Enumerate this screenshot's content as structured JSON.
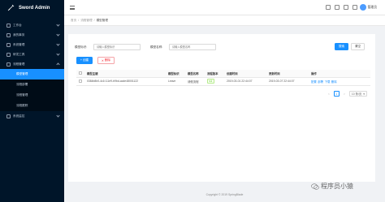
{
  "brand": {
    "title": "Sword Admin",
    "logo_icon": "sword-icon"
  },
  "sidebar": {
    "items": [
      {
        "label": "工作台",
        "icon": "desktop-icon",
        "open": false
      },
      {
        "label": "我的事务",
        "icon": "inbox-icon",
        "open": false
      },
      {
        "label": "系统管理",
        "icon": "setting-icon",
        "open": false
      },
      {
        "label": "研发工具",
        "icon": "tool-icon",
        "open": false
      },
      {
        "label": "流程管理",
        "icon": "flow-icon",
        "open": true
      }
    ],
    "subitems": [
      {
        "label": "模型管理",
        "active": true
      },
      {
        "label": "流程部署",
        "active": false
      },
      {
        "label": "流程管理",
        "active": false
      },
      {
        "label": "流程跟踪",
        "active": false
      }
    ],
    "tail": {
      "label": "系统监控",
      "icon": "monitor-icon"
    }
  },
  "header": {
    "user_name": "管理员"
  },
  "breadcrumb": {
    "home": "首页",
    "parent": "流程管理",
    "current": "模型管理"
  },
  "search": {
    "key_label": "模型标识:",
    "key_placeholder": "请输入模型标识",
    "name_label": "模型名称:",
    "name_placeholder": "请输入模型名称",
    "search_button": "搜索",
    "reset_button": "清空"
  },
  "toolbar": {
    "create_button": "+ 创建",
    "delete_button": "删除"
  },
  "table": {
    "headers": [
      "模型主键",
      "模型标识",
      "模型名称",
      "流程版本",
      "创建时间",
      "更新时间",
      "操作"
    ],
    "rows": [
      {
        "id": "0384b8b0-4c1f-11e9-b9bd-acde48001122",
        "key": "Leave",
        "name": "请假流程",
        "version": "v1",
        "created": "2019-03-01 22:44:07",
        "updated": "2019-03-07 22:44:07",
        "actions": [
          "配置",
          "部署",
          "下载",
          "删除"
        ]
      }
    ]
  },
  "pagination": {
    "prev": "<",
    "page": "1",
    "next": ">",
    "page_size": "10 条/页"
  },
  "footer": {
    "text": "Copyright © 2019 SpringBlade"
  },
  "watermark": {
    "text": "程序员小猿"
  },
  "colors": {
    "sidebar_bg": "#001529",
    "accent": "#1890ff",
    "danger": "#f5222d"
  }
}
